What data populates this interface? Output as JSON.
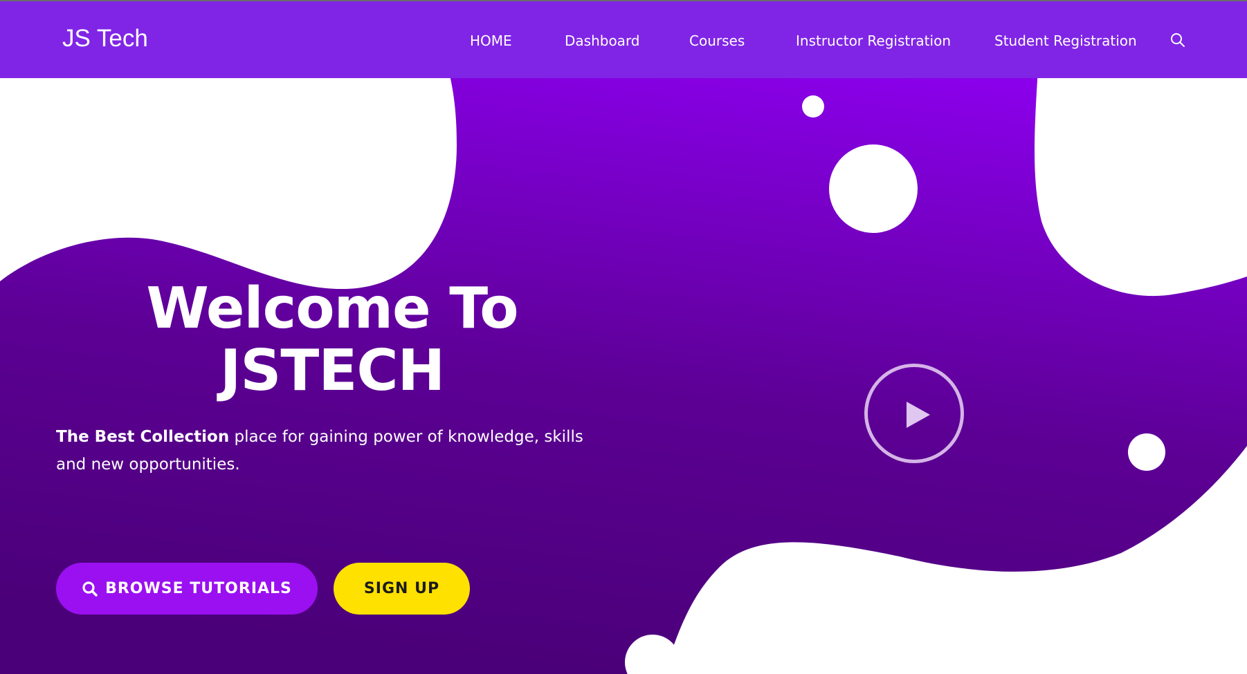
{
  "navbar": {
    "brand": "JS Tech",
    "links": [
      "HOME",
      "Dashboard",
      "Courses",
      "Instructor Registration",
      "Student Registration"
    ],
    "search_icon": "search-icon"
  },
  "hero": {
    "title_line1": "Welcome To",
    "title_line2": "JSTECH",
    "text_bold": "The Best Collection",
    "text_line1_rest": " place for gaining power of knowledge, skills",
    "text_line2": "and new opportunities.",
    "browse_button": "BROWSE TUTORIALS",
    "browse_icon": "search-icon",
    "signup_button": "SIGN UP",
    "play_icon": "play-icon"
  },
  "colors": {
    "navbar": "#8025e6",
    "hero_top": "#8a00ea",
    "hero_bottom": "#4a0078",
    "browse_button": "#9a10f0",
    "signup_button": "#ffe100"
  }
}
